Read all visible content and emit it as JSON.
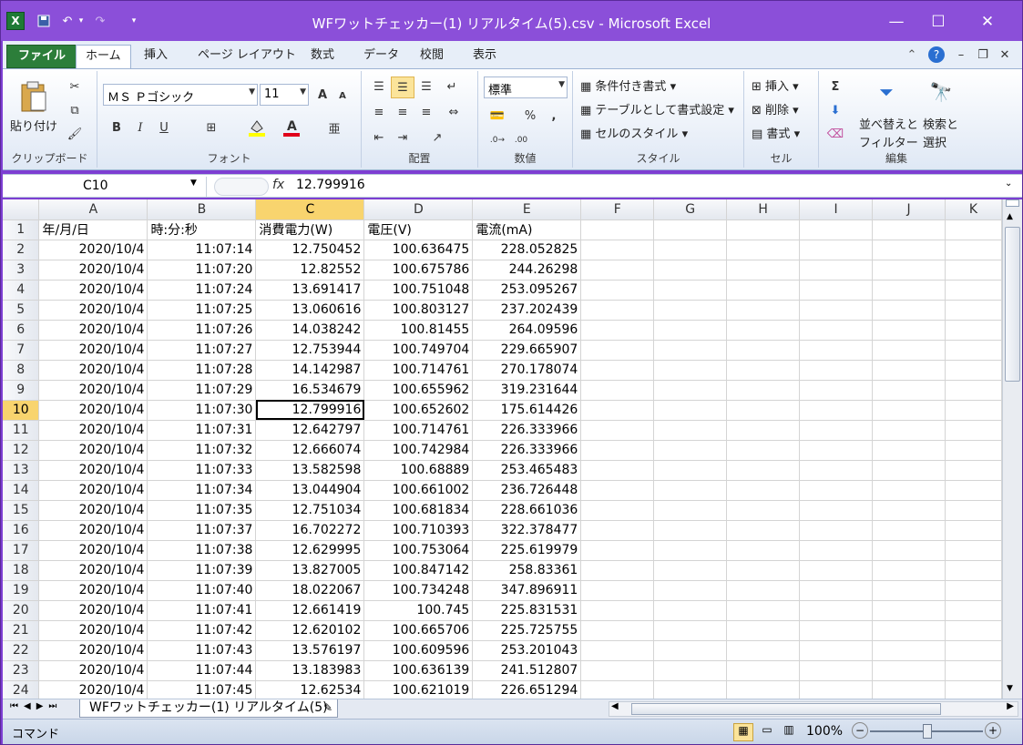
{
  "titlebar": {
    "app_icon": "X",
    "save_icon": "save-icon",
    "undo": "↶",
    "redo": "↷",
    "qa_more": "▾",
    "title": "WFワットチェッカー(1) リアルタイム(5).csv - Microsoft Excel",
    "minimize": "—",
    "maximize": "☐",
    "close": "✕"
  },
  "tabs": {
    "file": "ファイル",
    "home": "ホーム",
    "insert": "挿入",
    "layout": "ページ レイアウト",
    "formulas": "数式",
    "data": "データ",
    "review": "校閲",
    "view": "表示"
  },
  "ribbon": {
    "clipboard": {
      "label": "クリップボード",
      "paste": "貼り付け"
    },
    "font": {
      "label": "フォント",
      "name": "ＭＳ Ｐゴシック",
      "size": "11",
      "bold": "B",
      "italic": "I",
      "underline": "U",
      "grow": "A",
      "shrink": "A"
    },
    "align": {
      "label": "配置"
    },
    "number": {
      "label": "数値",
      "format": "標準",
      "percent": "%",
      "comma": ","
    },
    "style": {
      "label": "スタイル",
      "cond": "条件付き書式",
      "table": "テーブルとして書式設定",
      "cell": "セルのスタイル"
    },
    "cells": {
      "label": "セル",
      "insert": "挿入",
      "delete": "削除",
      "format": "書式"
    },
    "edit": {
      "label": "編集",
      "sum": "Σ",
      "sort1": "並べ替えと",
      "sort2": "フィルター",
      "find1": "検索と",
      "find2": "選択"
    }
  },
  "formula": {
    "name_box": "C10",
    "fx": "fx",
    "value": "12.799916"
  },
  "columns": [
    "A",
    "B",
    "C",
    "D",
    "E",
    "F",
    "G",
    "H",
    "I",
    "J",
    "K"
  ],
  "header_row": [
    "年/月/日",
    "時:分:秒",
    "消費電力(W)",
    "電圧(V)",
    "電流(mA)"
  ],
  "rows": [
    [
      "2020/10/4",
      "11:07:14",
      "12.750452",
      "100.636475",
      "228.052825"
    ],
    [
      "2020/10/4",
      "11:07:20",
      "12.82552",
      "100.675786",
      "244.26298"
    ],
    [
      "2020/10/4",
      "11:07:24",
      "13.691417",
      "100.751048",
      "253.095267"
    ],
    [
      "2020/10/4",
      "11:07:25",
      "13.060616",
      "100.803127",
      "237.202439"
    ],
    [
      "2020/10/4",
      "11:07:26",
      "14.038242",
      "100.81455",
      "264.09596"
    ],
    [
      "2020/10/4",
      "11:07:27",
      "12.753944",
      "100.749704",
      "229.665907"
    ],
    [
      "2020/10/4",
      "11:07:28",
      "14.142987",
      "100.714761",
      "270.178074"
    ],
    [
      "2020/10/4",
      "11:07:29",
      "16.534679",
      "100.655962",
      "319.231644"
    ],
    [
      "2020/10/4",
      "11:07:30",
      "12.799916",
      "100.652602",
      "175.614426"
    ],
    [
      "2020/10/4",
      "11:07:31",
      "12.642797",
      "100.714761",
      "226.333966"
    ],
    [
      "2020/10/4",
      "11:07:32",
      "12.666074",
      "100.742984",
      "226.333966"
    ],
    [
      "2020/10/4",
      "11:07:33",
      "13.582598",
      "100.68889",
      "253.465483"
    ],
    [
      "2020/10/4",
      "11:07:34",
      "13.044904",
      "100.661002",
      "236.726448"
    ],
    [
      "2020/10/4",
      "11:07:35",
      "12.751034",
      "100.681834",
      "228.661036"
    ],
    [
      "2020/10/4",
      "11:07:37",
      "16.702272",
      "100.710393",
      "322.378477"
    ],
    [
      "2020/10/4",
      "11:07:38",
      "12.629995",
      "100.753064",
      "225.619979"
    ],
    [
      "2020/10/4",
      "11:07:39",
      "13.827005",
      "100.847142",
      "258.83361"
    ],
    [
      "2020/10/4",
      "11:07:40",
      "18.022067",
      "100.734248",
      "347.896911"
    ],
    [
      "2020/10/4",
      "11:07:41",
      "12.661419",
      "100.745",
      "225.831531"
    ],
    [
      "2020/10/4",
      "11:07:42",
      "12.620102",
      "100.665706",
      "225.725755"
    ],
    [
      "2020/10/4",
      "11:07:43",
      "13.576197",
      "100.609596",
      "253.201043"
    ],
    [
      "2020/10/4",
      "11:07:44",
      "13.183983",
      "100.636139",
      "241.512807"
    ],
    [
      "2020/10/4",
      "11:07:45",
      "12.62534",
      "100.621019",
      "226.651294"
    ]
  ],
  "sheet_tab": "WFワットチェッカー(1) リアルタイム(5)",
  "status": {
    "mode": "コマンド",
    "zoom": "100%",
    "minus": "−",
    "plus": "+"
  },
  "colors": {
    "title": "#8b4fd9",
    "file_tab": "#2c7e3a",
    "selected_header": "#f8d46e"
  }
}
